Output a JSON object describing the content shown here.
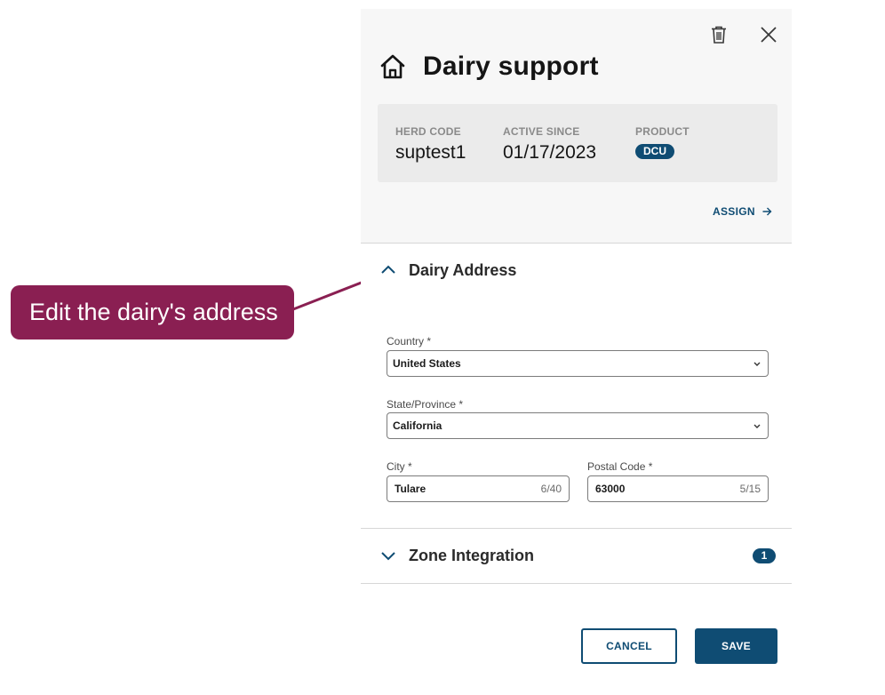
{
  "callout": {
    "text": "Edit the dairy's address"
  },
  "panel": {
    "title": "Dairy support",
    "info": {
      "herd_code_label": "HERD CODE",
      "herd_code_value": "suptest1",
      "active_since_label": "ACTIVE SINCE",
      "active_since_value": "01/17/2023",
      "product_label": "PRODUCT",
      "product_value": "DCU"
    },
    "assign_label": "ASSIGN",
    "icons": {
      "delete": "trash-icon",
      "close": "close-icon",
      "title": "home-icon",
      "assign": "arrow-right-icon"
    }
  },
  "dairy_address": {
    "title": "Dairy Address",
    "expanded": true,
    "country": {
      "label": "Country *",
      "value": "United States"
    },
    "state": {
      "label": "State/Province *",
      "value": "California"
    },
    "city": {
      "label": "City *",
      "value": "Tulare",
      "counter": "6/40"
    },
    "postal": {
      "label": "Postal Code *",
      "value": "63000",
      "counter": "5/15"
    }
  },
  "zone_integration": {
    "title": "Zone Integration",
    "count": "1",
    "expanded": false
  },
  "actions": {
    "cancel_label": "CANCEL",
    "save_label": "SAVE"
  },
  "colors": {
    "primary": "#0f4c73",
    "callout": "#8a1f52",
    "header_bg": "#f7f7f7",
    "card_bg": "#ebebeb"
  }
}
